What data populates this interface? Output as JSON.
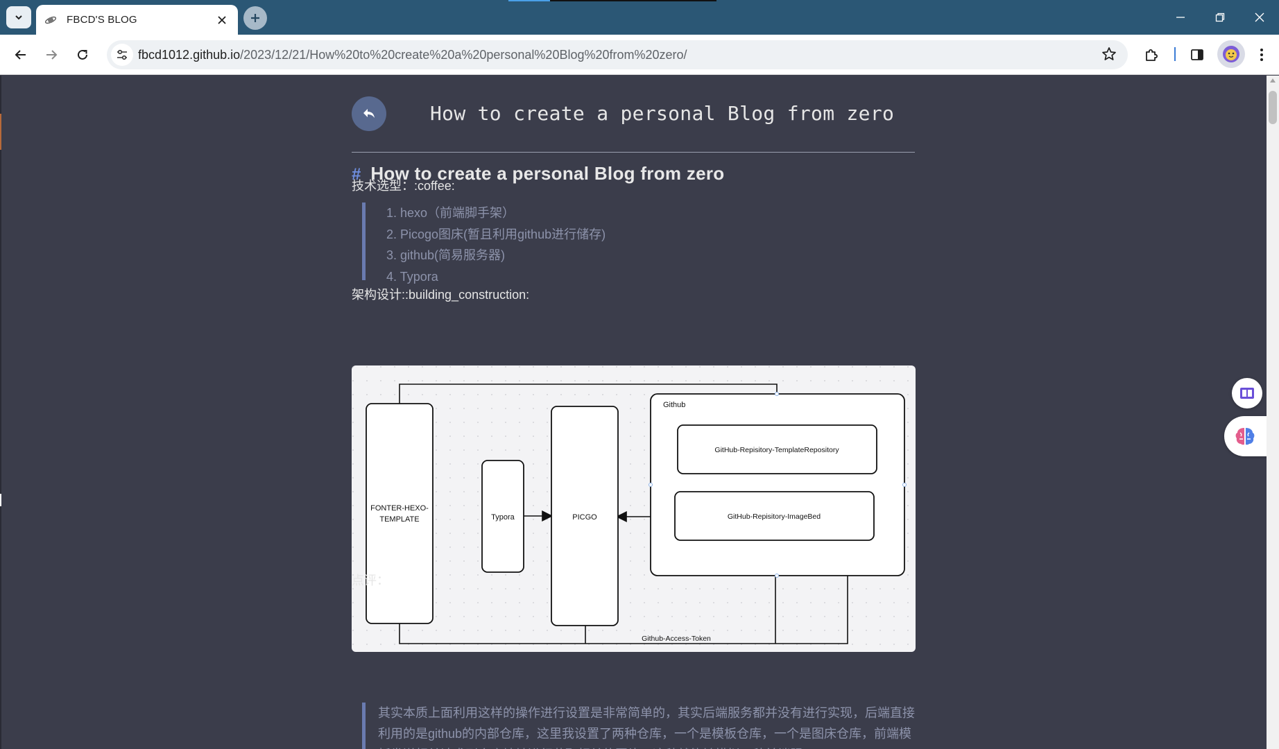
{
  "browser": {
    "tab_title": "FBCD'S BLOG",
    "url_domain": "fbcd1012.github.io",
    "url_path": "/2023/12/21/How%20to%20create%20a%20personal%20Blog%20from%20zero/",
    "accent_color": "#2b5775"
  },
  "page": {
    "header_title": "How to create a personal Blog from zero",
    "heading_hash": "#",
    "heading": "How to create a personal Blog from zero",
    "tech_label": "技术选型：:coffee:",
    "tech_items": [
      "1. hexo（前端脚手架）",
      "2. Picogo图床(暂且利用github进行储存)",
      "3. github(简易服务器)",
      "4. Typora"
    ],
    "arch_label": "架构设计::building_construction:",
    "review_label": "点评：",
    "review_text": "其实本质上面利用这样的操作进行设置是非常简单的，其实后端服务都并没有进行实现，后端直接利用的是github的内部仓库，这里我设置了两种仓库，一个是模板仓库，一个是图床仓库，前端模板发送相关请求到仓库地址进行获取相关的图片，这种就能够模拟一种前端服"
  },
  "diagram": {
    "fonter": [
      "FONTER-HEXO-",
      "TEMPLATE"
    ],
    "typora": "Typora",
    "picgo": "PICGO",
    "github": "Github",
    "template_repo": "GitHub-Repisitory-TemplateRepository",
    "imagebed_repo": "GitHub-Repisitory-ImageBed",
    "access_token": "Github-Access-Token"
  }
}
